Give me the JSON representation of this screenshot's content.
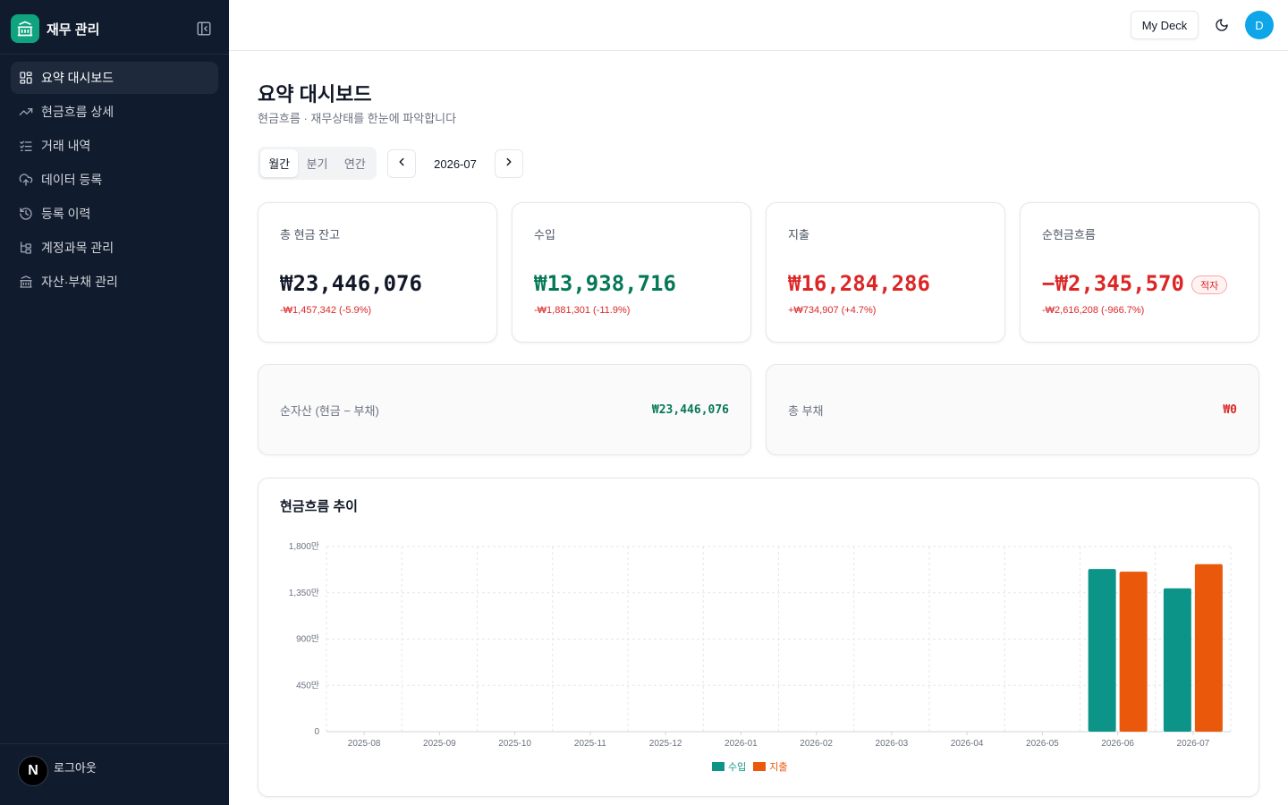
{
  "sidebar": {
    "brand": "재무 관리",
    "items": [
      {
        "label": "요약 대시보드",
        "icon": "dashboard-icon",
        "active": true
      },
      {
        "label": "현금흐름 상세",
        "icon": "trending-up-icon"
      },
      {
        "label": "거래 내역",
        "icon": "list-checks-icon"
      },
      {
        "label": "데이터 등록",
        "icon": "cloud-upload-icon"
      },
      {
        "label": "등록 이력",
        "icon": "history-icon"
      },
      {
        "label": "계정과목 관리",
        "icon": "tree-icon"
      },
      {
        "label": "자산·부채 관리",
        "icon": "bank-icon"
      }
    ],
    "logout_label": "로그아웃",
    "logout_avatar": "N"
  },
  "topbar": {
    "deck_label": "My Deck",
    "avatar_letter": "D"
  },
  "page": {
    "title": "요약 대시보드",
    "subtitle": "현금흐름 · 재무상태를 한눈에 파악합니다"
  },
  "period": {
    "tabs": [
      "월간",
      "분기",
      "연간"
    ],
    "active_tab": "월간",
    "current": "2026-07"
  },
  "kpis": [
    {
      "label": "총 현금 잔고",
      "value": "₩23,446,076",
      "delta": "-₩1,457,342 (-5.9%)",
      "color": "#111827"
    },
    {
      "label": "수입",
      "value": "₩13,938,716",
      "delta": "-₩1,881,301 (-11.9%)",
      "color": "#047857"
    },
    {
      "label": "지출",
      "value": "₩16,284,286",
      "delta": "+₩734,907 (+4.7%)",
      "color": "#dc2626"
    },
    {
      "label": "순현금흐름",
      "value": "−₩2,345,570",
      "delta": "-₩2,616,208 (-966.7%)",
      "color": "#dc2626",
      "badge": "적자"
    }
  ],
  "summary": {
    "net_assets": {
      "label": "순자산 (현금 − 부채)",
      "value": "₩23,446,076",
      "color": "#047857"
    },
    "liabilities": {
      "label": "총 부채",
      "value": "₩0",
      "color": "#dc2626"
    }
  },
  "chart_title": "현금흐름 추이",
  "colors": {
    "income": "#0d9488",
    "expense": "#ea580c",
    "sidebar_bg": "#111b2e",
    "accent": "#10a37f"
  },
  "chart_data": {
    "type": "bar",
    "categories": [
      "2025-08",
      "2025-09",
      "2025-10",
      "2025-11",
      "2025-12",
      "2026-01",
      "2026-02",
      "2026-03",
      "2026-04",
      "2026-05",
      "2026-06",
      "2026-07"
    ],
    "series": [
      {
        "name": "수입",
        "values": [
          0,
          0,
          0,
          0,
          0,
          0,
          0,
          0,
          0,
          0,
          15820017,
          13938716
        ]
      },
      {
        "name": "지출",
        "values": [
          0,
          0,
          0,
          0,
          0,
          0,
          0,
          0,
          0,
          0,
          15549379,
          16284286
        ]
      }
    ],
    "y_ticks": [
      "0",
      "450만",
      "900만",
      "1,350만",
      "1,800만"
    ],
    "ylim": [
      0,
      18000000
    ],
    "grid": true,
    "legend": "bottom-center"
  }
}
